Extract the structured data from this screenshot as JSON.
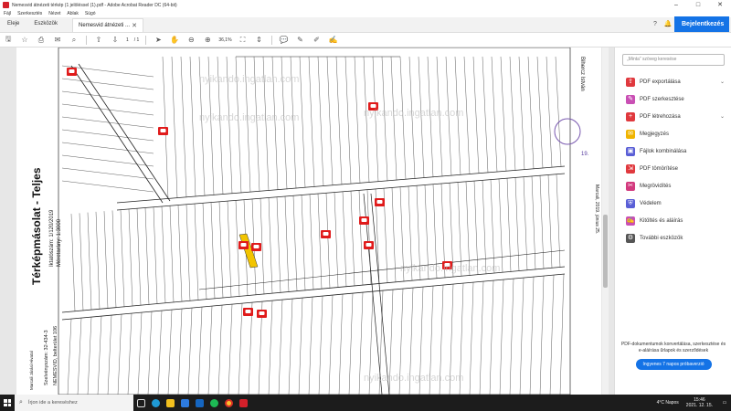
{
  "window": {
    "title": "Nemesvid átnézeti térkép (1 jelöléssel (1).pdf - Adobe Acrobat Reader DC (64-bit)",
    "minimize": "–",
    "maximize": "□",
    "close": "✕"
  },
  "menu": [
    "Fájl",
    "Szerkesztés",
    "Nézet",
    "Ablak",
    "Súgó"
  ],
  "tabs": {
    "home": "Eleje",
    "tools": "Eszközök",
    "doc": "Nemesvid átnézeti ...",
    "doc_close": "✕",
    "help": "?",
    "bell": "🔔",
    "signin": "Bejelentkezés"
  },
  "toolbar": {
    "page_current": "1",
    "page_total": "/ 1",
    "zoom": "36,1%"
  },
  "map": {
    "title": "Térképmásolat - Teljes",
    "date": "Iktatószám: 1/120/2019",
    "scale": "Méretarány: 1:3000",
    "office": "Marcali Járási Hivatal",
    "sheet": "Szelvényszám: 32-434-3",
    "settlement": "NEMESVID, belterület 106",
    "signature": "Bihercz István",
    "issued": "Marcali, 2019. június 25.",
    "stamp_date": "19.",
    "watermark": "nyikando.ingatlan.com"
  },
  "rightpane": {
    "search_placeholder": "„Minta” szöveg keresése",
    "tools": [
      {
        "label": "PDF exportálása",
        "color": "#e0393e",
        "glyph": "⇪",
        "chevron": "⌄"
      },
      {
        "label": "PDF szerkesztése",
        "color": "#c94fb4",
        "glyph": "✎",
        "chevron": ""
      },
      {
        "label": "PDF létrehozása",
        "color": "#e0393e",
        "glyph": "+",
        "chevron": "⌄"
      },
      {
        "label": "Megjegyzés",
        "color": "#f0b400",
        "glyph": "✉",
        "chevron": ""
      },
      {
        "label": "Fájlok kombinálása",
        "color": "#5a5fd6",
        "glyph": "▣",
        "chevron": ""
      },
      {
        "label": "PDF tömörítése",
        "color": "#e0393e",
        "glyph": "⇲",
        "chevron": ""
      },
      {
        "label": "Megrövidítés",
        "color": "#d33a7e",
        "glyph": "✂",
        "chevron": ""
      },
      {
        "label": "Védelem",
        "color": "#5a5fd6",
        "glyph": "⛨",
        "chevron": ""
      },
      {
        "label": "Kitöltés és aláírás",
        "color": "#c94fb4",
        "glyph": "✍",
        "chevron": ""
      },
      {
        "label": "További eszközök",
        "color": "#555555",
        "glyph": "⚙",
        "chevron": ""
      }
    ],
    "promo_text": "PDF-dokumentumok konvertálása, szerkesztése és e-aláírása űrlapok és szerződések",
    "promo_button": "Ingyenes 7 napos próbaverzió"
  },
  "taskbar": {
    "search_placeholder": "Írjon ide a kereséshez",
    "weather": "4°C Napos",
    "time": "15:46",
    "date": "2021. 12. 15."
  },
  "colors": {
    "accent": "#1473e6",
    "marker": "#e01b1b",
    "highlight": "#f2c400"
  }
}
